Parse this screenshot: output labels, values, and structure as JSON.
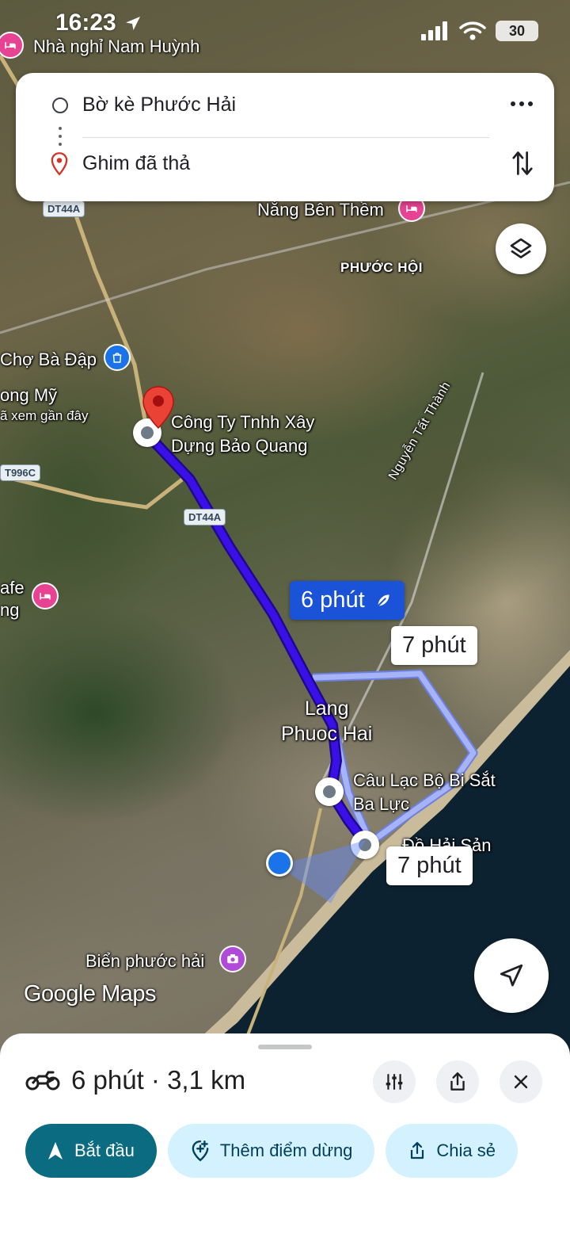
{
  "status_bar": {
    "time": "16:23",
    "battery": "30"
  },
  "directions": {
    "origin": "Bờ kè Phước Hải",
    "destination": "Ghim đã thả"
  },
  "map": {
    "labels": {
      "top_poi": "Nhà nghỉ Nam Huỳnh",
      "nang_ben_them": "Nắng Bên Thềm",
      "phuoc_hoi": "PHƯỚC HỘI",
      "cho_ba_dap": "Chợ Bà Đập",
      "ong_my": "ong Mỹ",
      "recently_viewed": "ã xem gần đây",
      "company": "Công Ty Tnhh Xây\nDựng Bảo Quang",
      "nguyen_tat_thanh": "Nguyễn Tất Thành",
      "cafe": "afe\nng",
      "lang_phuoc_hai": "Lang\nPhuoc Hai",
      "clb": "Câu Lạc Bộ Bi Sắt\nBa Lực",
      "hai_san": "Đồ Hải Sản",
      "bien_phuoc_hai": "Biển phước hải"
    },
    "road_shields": {
      "dt44a_top": "DT44A",
      "dt44a_mid": "DT44A",
      "t996c": "T996C"
    },
    "route_callouts": {
      "primary": "6 phút",
      "alt1": "7 phút",
      "alt2": "7 phút"
    },
    "logo": "Google Maps",
    "colors": {
      "route_primary": "#3b10e8",
      "route_alt": "#a6b4f7",
      "callout_primary": "#1a52d8"
    }
  },
  "sheet": {
    "summary": "6 phút · 3,1 km",
    "chips": {
      "start": "Bắt đầu",
      "add_stop": "Thêm điểm dừng",
      "share": "Chia sẻ"
    }
  }
}
